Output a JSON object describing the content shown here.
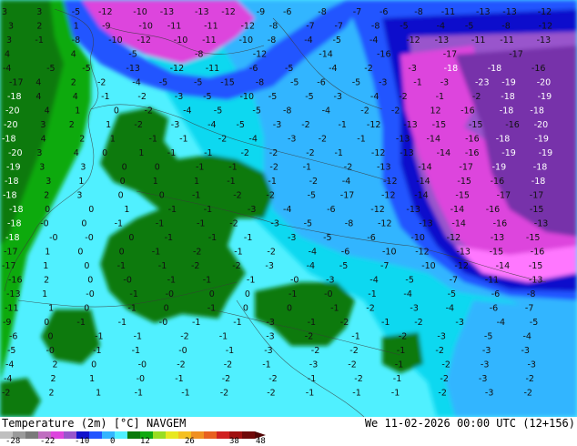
{
  "title": "Temperature (2m) [°C] NAVGEM",
  "valid_time": "We 11-02-2026 00:00 UTC (12+156)",
  "colorbar": {
    "tick_labels": [
      "-28",
      "-22",
      "-10",
      "0",
      "12",
      "26",
      "38",
      "48"
    ]
  },
  "colors": {
    "dark_green": "#0a7a0a",
    "green": "#11aa11",
    "cyan": "#10d8f0",
    "light_cyan": "#50f0ff",
    "light_blue": "#33b5ff",
    "blue": "#2255ff",
    "dark_blue": "#1111cc",
    "purple": "#9955cc",
    "magenta": "#dd44dd",
    "pink": "#ff77ff"
  },
  "map_labels": [
    {
      "t": "3"
    },
    {
      "t": "3"
    },
    {
      "t": "-5"
    },
    {
      "t": "-12"
    },
    {
      "t": "-10"
    },
    {
      "t": "-13"
    },
    {
      "t": "-13"
    },
    {
      "t": "-12"
    },
    {
      "t": "-9"
    },
    {
      "t": "-6"
    },
    {
      "t": "-8"
    },
    {
      "t": "-7"
    },
    {
      "t": "-6"
    },
    {
      "t": "-8"
    },
    {
      "t": "-11"
    },
    {
      "t": "-13"
    },
    {
      "t": "-13"
    },
    {
      "t": "-12"
    },
    {
      "t": "3"
    },
    {
      "t": "2"
    },
    {
      "t": "1"
    },
    {
      "t": "-9"
    },
    {
      "t": "-10"
    },
    {
      "t": "-11"
    },
    {
      "t": "-11"
    },
    {
      "t": "-12"
    },
    {
      "t": "-8"
    },
    {
      "t": "-7"
    },
    {
      "t": "-7"
    },
    {
      "t": "-8"
    },
    {
      "t": "-5"
    },
    {
      "t": "-4"
    },
    {
      "t": "-5"
    },
    {
      "t": "-8"
    },
    {
      "t": "-12"
    },
    {
      "t": "3"
    },
    {
      "t": "-1"
    },
    {
      "t": "-8"
    },
    {
      "t": "-10"
    },
    {
      "t": "-12"
    },
    {
      "t": "-10"
    },
    {
      "t": "-11"
    },
    {
      "t": "-10"
    },
    {
      "t": "-8"
    },
    {
      "t": "-4"
    },
    {
      "t": "-5"
    },
    {
      "t": "-4"
    },
    {
      "t": "-12"
    },
    {
      "t": "-13"
    },
    {
      "t": "-11"
    },
    {
      "t": "-11"
    },
    {
      "t": "-13"
    },
    {
      "t": "4"
    },
    {
      "t": "4"
    },
    {
      "t": "-5"
    },
    {
      "t": "-8"
    },
    {
      "t": "-12"
    },
    {
      "t": "-14"
    },
    {
      "t": "-16"
    },
    {
      "t": "-17"
    },
    {
      "t": "-17"
    },
    {
      "t": "-4"
    },
    {
      "t": "-5"
    },
    {
      "t": "-5"
    },
    {
      "t": "-13"
    },
    {
      "t": "-12"
    },
    {
      "t": "-11"
    },
    {
      "t": "-6"
    },
    {
      "t": "-5"
    },
    {
      "t": "-4"
    },
    {
      "t": "-2"
    },
    {
      "t": "-3"
    },
    {
      "t": "-18"
    },
    {
      "t": "-18"
    },
    {
      "t": "-16"
    },
    {
      "t": "-17"
    },
    {
      "t": "4"
    },
    {
      "t": "2"
    },
    {
      "t": "-2"
    },
    {
      "t": "-4"
    },
    {
      "t": "-5"
    },
    {
      "t": "-5"
    },
    {
      "t": "-15"
    },
    {
      "t": "-8"
    },
    {
      "t": "-5"
    },
    {
      "t": "-6"
    },
    {
      "t": "-5"
    },
    {
      "t": "-3"
    },
    {
      "t": "-1"
    },
    {
      "t": "-3"
    },
    {
      "t": "-23"
    },
    {
      "t": "-19"
    },
    {
      "t": "-20"
    },
    {
      "t": "-18"
    },
    {
      "t": "4"
    },
    {
      "t": "4"
    },
    {
      "t": "-1"
    },
    {
      "t": "-2"
    },
    {
      "t": "-3"
    },
    {
      "t": "-5"
    },
    {
      "t": "-10"
    },
    {
      "t": "-5"
    },
    {
      "t": "-5"
    },
    {
      "t": "-3"
    },
    {
      "t": "-4"
    },
    {
      "t": "-2"
    },
    {
      "t": "-1"
    },
    {
      "t": "-2"
    },
    {
      "t": "-18"
    },
    {
      "t": "-19"
    },
    {
      "t": "-20"
    },
    {
      "t": "4"
    },
    {
      "t": "1"
    },
    {
      "t": "0"
    },
    {
      "t": "-2"
    },
    {
      "t": "-4"
    },
    {
      "t": "-5"
    },
    {
      "t": "-5"
    },
    {
      "t": "-8"
    },
    {
      "t": "-4"
    },
    {
      "t": "-2"
    },
    {
      "t": "-2"
    },
    {
      "t": "12"
    },
    {
      "t": "-16"
    },
    {
      "t": "-18"
    },
    {
      "t": "-18"
    },
    {
      "t": "-20"
    },
    {
      "t": "3"
    },
    {
      "t": "2"
    },
    {
      "t": "1"
    },
    {
      "t": "-2"
    },
    {
      "t": "-3"
    },
    {
      "t": "-4"
    },
    {
      "t": "-5"
    },
    {
      "t": "-3"
    },
    {
      "t": "-2"
    },
    {
      "t": "-1"
    },
    {
      "t": "-12"
    },
    {
      "t": "-13"
    },
    {
      "t": "-15"
    },
    {
      "t": "-15"
    },
    {
      "t": "-16"
    },
    {
      "t": "-20"
    },
    {
      "t": "-18"
    },
    {
      "t": "4"
    },
    {
      "t": "2"
    },
    {
      "t": "1"
    },
    {
      "t": "-1"
    },
    {
      "t": "-1"
    },
    {
      "t": "-2"
    },
    {
      "t": "-4"
    },
    {
      "t": "-3"
    },
    {
      "t": "-2"
    },
    {
      "t": "-1"
    },
    {
      "t": "-13"
    },
    {
      "t": "-14"
    },
    {
      "t": "-16"
    },
    {
      "t": "-18"
    },
    {
      "t": "-19"
    },
    {
      "t": "-20"
    },
    {
      "t": "3"
    },
    {
      "t": "4"
    },
    {
      "t": "0"
    },
    {
      "t": "1"
    },
    {
      "t": "-1"
    },
    {
      "t": "-1"
    },
    {
      "t": "-2"
    },
    {
      "t": "-2"
    },
    {
      "t": "-2"
    },
    {
      "t": "-1"
    },
    {
      "t": "-12"
    },
    {
      "t": "-13"
    },
    {
      "t": "-14"
    },
    {
      "t": "-16"
    },
    {
      "t": "-19"
    },
    {
      "t": "-19"
    },
    {
      "t": "-19"
    },
    {
      "t": "3"
    },
    {
      "t": "3"
    },
    {
      "t": "0"
    },
    {
      "t": "0"
    },
    {
      "t": "-1"
    },
    {
      "t": "-1"
    },
    {
      "t": "-2"
    },
    {
      "t": "-1"
    },
    {
      "t": "-2"
    },
    {
      "t": "-13"
    },
    {
      "t": "-14"
    },
    {
      "t": "-17"
    },
    {
      "t": "-19"
    },
    {
      "t": "-18"
    },
    {
      "t": "-18"
    },
    {
      "t": "3"
    },
    {
      "t": "1"
    },
    {
      "t": "0"
    },
    {
      "t": "1"
    },
    {
      "t": "1"
    },
    {
      "t": "-1"
    },
    {
      "t": "-1"
    },
    {
      "t": "-2"
    },
    {
      "t": "-4"
    },
    {
      "t": "-12"
    },
    {
      "t": "-14"
    },
    {
      "t": "-15"
    },
    {
      "t": "-16"
    },
    {
      "t": "-18"
    },
    {
      "t": "-18"
    },
    {
      "t": "2"
    },
    {
      "t": "3"
    },
    {
      "t": "0"
    },
    {
      "t": "0"
    },
    {
      "t": "-1"
    },
    {
      "t": "-2"
    },
    {
      "t": "-2"
    },
    {
      "t": "-5"
    },
    {
      "t": "-17"
    },
    {
      "t": "-12"
    },
    {
      "t": "-14"
    },
    {
      "t": "-15"
    },
    {
      "t": "-17"
    },
    {
      "t": "-17"
    },
    {
      "t": "-18"
    },
    {
      "t": "0"
    },
    {
      "t": "0"
    },
    {
      "t": "1"
    },
    {
      "t": "-1"
    },
    {
      "t": "-1"
    },
    {
      "t": "-3"
    },
    {
      "t": "-4"
    },
    {
      "t": "-6"
    },
    {
      "t": "-12"
    },
    {
      "t": "-13"
    },
    {
      "t": "-14"
    },
    {
      "t": "-16"
    },
    {
      "t": "-15"
    },
    {
      "t": "-18"
    },
    {
      "t": "-0"
    },
    {
      "t": "0"
    },
    {
      "t": "-1"
    },
    {
      "t": "-1"
    },
    {
      "t": "-1"
    },
    {
      "t": "-2"
    },
    {
      "t": "-3"
    },
    {
      "t": "-5"
    },
    {
      "t": "-8"
    },
    {
      "t": "-12"
    },
    {
      "t": "-13"
    },
    {
      "t": "-14"
    },
    {
      "t": "-16"
    },
    {
      "t": "-13"
    },
    {
      "t": "-18"
    },
    {
      "t": "-0"
    },
    {
      "t": "-0"
    },
    {
      "t": "0"
    },
    {
      "t": "-1"
    },
    {
      "t": "-1"
    },
    {
      "t": "-1"
    },
    {
      "t": "-3"
    },
    {
      "t": "-5"
    },
    {
      "t": "-6"
    },
    {
      "t": "-10"
    },
    {
      "t": "-12"
    },
    {
      "t": "-13"
    },
    {
      "t": "-15"
    },
    {
      "t": "-17"
    },
    {
      "t": "1"
    },
    {
      "t": "0"
    },
    {
      "t": "0"
    },
    {
      "t": "-1"
    },
    {
      "t": "-2"
    },
    {
      "t": "-1"
    },
    {
      "t": "-2"
    },
    {
      "t": "-4"
    },
    {
      "t": "-6"
    },
    {
      "t": "-10"
    },
    {
      "t": "-12"
    },
    {
      "t": "-13"
    },
    {
      "t": "-15"
    },
    {
      "t": "-16"
    },
    {
      "t": "-17"
    },
    {
      "t": "1"
    },
    {
      "t": "0"
    },
    {
      "t": "-1"
    },
    {
      "t": "-1"
    },
    {
      "t": "-2"
    },
    {
      "t": "-2"
    },
    {
      "t": "-3"
    },
    {
      "t": "-4"
    },
    {
      "t": "-5"
    },
    {
      "t": "-7"
    },
    {
      "t": "-10"
    },
    {
      "t": "-12"
    },
    {
      "t": "-14"
    },
    {
      "t": "-15"
    },
    {
      "t": "-16"
    },
    {
      "t": "2"
    },
    {
      "t": "0"
    },
    {
      "t": "-0"
    },
    {
      "t": "-1"
    },
    {
      "t": "-1"
    },
    {
      "t": "-1"
    },
    {
      "t": "-0"
    },
    {
      "t": "-3"
    },
    {
      "t": "-4"
    },
    {
      "t": "-5"
    },
    {
      "t": "-7"
    },
    {
      "t": "-11"
    },
    {
      "t": "-13"
    },
    {
      "t": "-13"
    },
    {
      "t": "1"
    },
    {
      "t": "-0"
    },
    {
      "t": "-1"
    },
    {
      "t": "-0"
    },
    {
      "t": "0"
    },
    {
      "t": "0"
    },
    {
      "t": "-1"
    },
    {
      "t": "-0"
    },
    {
      "t": "-1"
    },
    {
      "t": "-4"
    },
    {
      "t": "-5"
    },
    {
      "t": "-6"
    },
    {
      "t": "-8"
    },
    {
      "t": "-11"
    },
    {
      "t": "1"
    },
    {
      "t": "0"
    },
    {
      "t": "-1"
    },
    {
      "t": "0"
    },
    {
      "t": "-1"
    },
    {
      "t": "0"
    },
    {
      "t": "0"
    },
    {
      "t": "-1"
    },
    {
      "t": "-2"
    },
    {
      "t": "-3"
    },
    {
      "t": "-4"
    },
    {
      "t": "-6"
    },
    {
      "t": "-7"
    },
    {
      "t": "-9"
    },
    {
      "t": "0"
    },
    {
      "t": "-1"
    },
    {
      "t": "-1"
    },
    {
      "t": "-0"
    },
    {
      "t": "-1"
    },
    {
      "t": "-1"
    },
    {
      "t": "-3"
    },
    {
      "t": "-1"
    },
    {
      "t": "-2"
    },
    {
      "t": "-1"
    },
    {
      "t": "-2"
    },
    {
      "t": "-3"
    },
    {
      "t": "-4"
    },
    {
      "t": "-5"
    },
    {
      "t": "-6"
    },
    {
      "t": "0"
    },
    {
      "t": "-1"
    },
    {
      "t": "-1"
    },
    {
      "t": "-2"
    },
    {
      "t": "-1"
    },
    {
      "t": "-3"
    },
    {
      "t": "-2"
    },
    {
      "t": "-1"
    },
    {
      "t": "-2"
    },
    {
      "t": "-3"
    },
    {
      "t": "-5"
    },
    {
      "t": "-4"
    },
    {
      "t": "-5"
    },
    {
      "t": "-0"
    },
    {
      "t": "-1"
    },
    {
      "t": "-1"
    },
    {
      "t": "-0"
    },
    {
      "t": "-1"
    },
    {
      "t": "-3"
    },
    {
      "t": "-2"
    },
    {
      "t": "-2"
    },
    {
      "t": "-1"
    },
    {
      "t": "-2"
    },
    {
      "t": "-3"
    },
    {
      "t": "-3"
    },
    {
      "t": "-4"
    },
    {
      "t": "2"
    },
    {
      "t": "0"
    },
    {
      "t": "-0"
    },
    {
      "t": "-2"
    },
    {
      "t": "-2"
    },
    {
      "t": "-1"
    },
    {
      "t": "-3"
    },
    {
      "t": "-2"
    },
    {
      "t": "-1"
    },
    {
      "t": "-2"
    },
    {
      "t": "-3"
    },
    {
      "t": "-3"
    },
    {
      "t": "-4"
    },
    {
      "t": "2"
    },
    {
      "t": "1"
    },
    {
      "t": "-0"
    },
    {
      "t": "-1"
    },
    {
      "t": "-2"
    },
    {
      "t": "-2"
    },
    {
      "t": "-1"
    },
    {
      "t": "-2"
    },
    {
      "t": "-1"
    },
    {
      "t": "-2"
    },
    {
      "t": "-3"
    },
    {
      "t": "-2"
    },
    {
      "t": "-2"
    },
    {
      "t": "2"
    },
    {
      "t": "1"
    },
    {
      "t": "-1"
    },
    {
      "t": "-1"
    },
    {
      "t": "-2"
    },
    {
      "t": "-2"
    },
    {
      "t": "-1"
    },
    {
      "t": "-1"
    },
    {
      "t": "-1"
    },
    {
      "t": "-2"
    },
    {
      "t": "-3"
    },
    {
      "t": "-2"
    },
    {
      "t": "-1"
    }
  ]
}
